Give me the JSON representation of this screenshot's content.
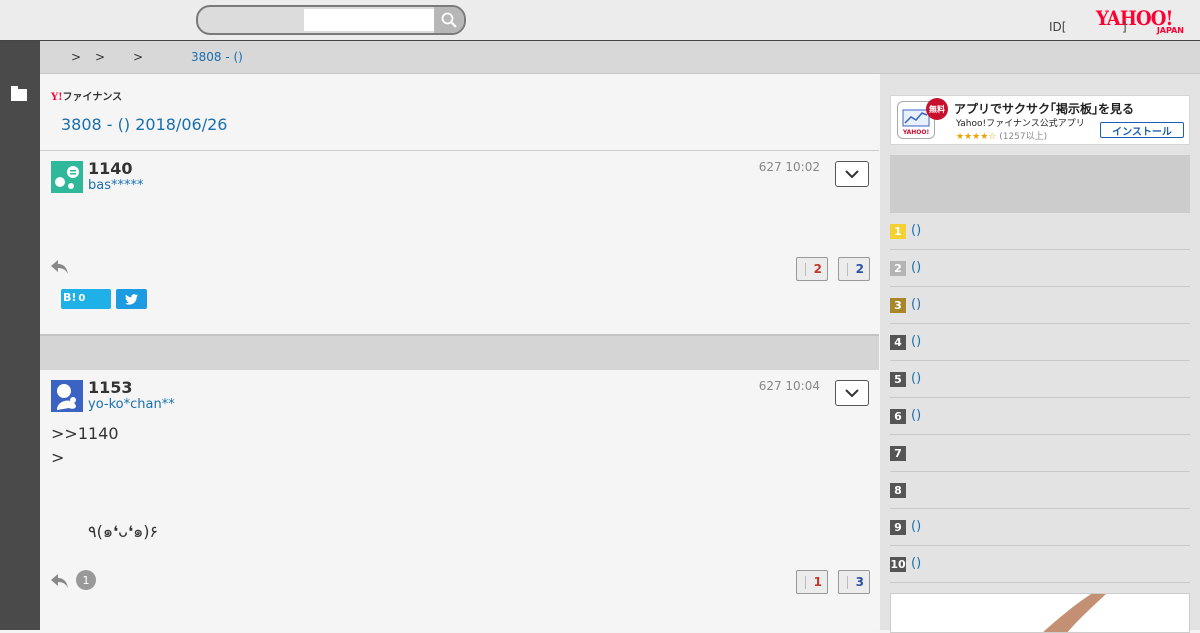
{
  "header": {
    "search_placeholder": "",
    "login_text": "ID[",
    "login_suffix": "]",
    "logo_word": "YAHOO!",
    "logo_sub": "JAPAN"
  },
  "breadcrumb": {
    "seps": [
      ">",
      ">",
      ">"
    ],
    "current": "3808 - ()"
  },
  "main": {
    "brand": "ファイナンス",
    "brand_y": "Y!",
    "title": "3808 - () 2018/06/26"
  },
  "posts": [
    {
      "number": "1140",
      "user": "bas*****",
      "date": "627 10:02",
      "body": [],
      "reply_count": "",
      "good": "2",
      "bad": "2",
      "hatena": "B!",
      "hatena_count": "0"
    },
    {
      "number": "1153",
      "user": "yo-ko*chan**",
      "date": "627 10:04",
      "body": [
        ">>1140",
        ">",
        "٩(๑❛ᴗ❛๑)۶"
      ],
      "reply_count": "1",
      "good": "1",
      "bad": "3"
    }
  ],
  "sidebar": {
    "app_banner": {
      "title": "アプリでサクサク｢掲示板｣を見る",
      "subtitle": "Yahoo!ファイナンス公式アプリ",
      "stars": "★★★★☆",
      "rating_count": "(1257以上)",
      "badge": "無料",
      "install": "インストール"
    },
    "ranking": [
      {
        "rank": "1",
        "label": "()",
        "color": "#f5d032"
      },
      {
        "rank": "2",
        "label": "()",
        "color": "#b4b4b4"
      },
      {
        "rank": "3",
        "label": "()",
        "color": "#a8862a"
      },
      {
        "rank": "4",
        "label": "()",
        "color": "#555555"
      },
      {
        "rank": "5",
        "label": "()",
        "color": "#555555"
      },
      {
        "rank": "6",
        "label": "()",
        "color": "#555555"
      },
      {
        "rank": "7",
        "label": "",
        "color": "#555555"
      },
      {
        "rank": "8",
        "label": "",
        "color": "#555555"
      },
      {
        "rank": "9",
        "label": "()",
        "color": "#555555"
      },
      {
        "rank": "10",
        "label": "()",
        "color": "#555555"
      }
    ]
  },
  "icons": [
    "search-icon",
    "folder-icon",
    "chevron-down-icon",
    "reply-icon",
    "twitter-icon",
    "avatar-icon"
  ]
}
